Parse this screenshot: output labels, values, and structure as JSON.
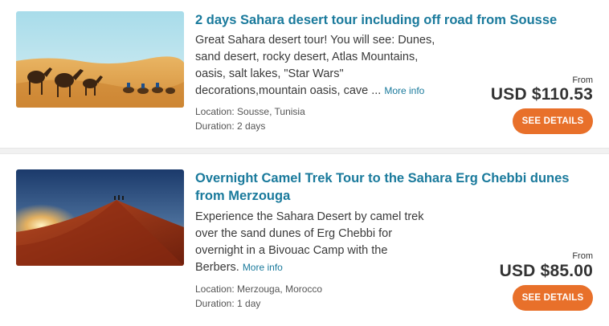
{
  "tours": [
    {
      "title": "2 days Sahara desert tour including off road from Sousse",
      "description": "Great Sahara desert tour! You will see: Dunes, sand desert, rocky desert, Atlas Mountains, oasis, salt lakes, \"Star Wars\" decorations,mountain oasis, cave ...",
      "more_info": "More info",
      "location": "Location: Sousse, Tunisia",
      "duration": "Duration: 2 days",
      "from_label": "From",
      "price": "USD $110.53",
      "button": "SEE DETAILS",
      "image": "camel-caravan-desert-photo"
    },
    {
      "title": "Overnight Camel Trek Tour to the Sahara Erg Chebbi dunes from Merzouga",
      "description": "Experience the Sahara Desert by camel trek over the sand dunes of Erg Chebbi for overnight in a Bivouac Camp with the Berbers.",
      "more_info": "More info",
      "location": "Location: Merzouga, Morocco",
      "duration": "Duration: 1 day",
      "from_label": "From",
      "price": "USD $85.00",
      "button": "SEE DETAILS",
      "image": "sunset-dune-photo"
    }
  ],
  "colors": {
    "title": "#1a7a9c",
    "button": "#e8702a",
    "divider": "#f1f1f1"
  }
}
